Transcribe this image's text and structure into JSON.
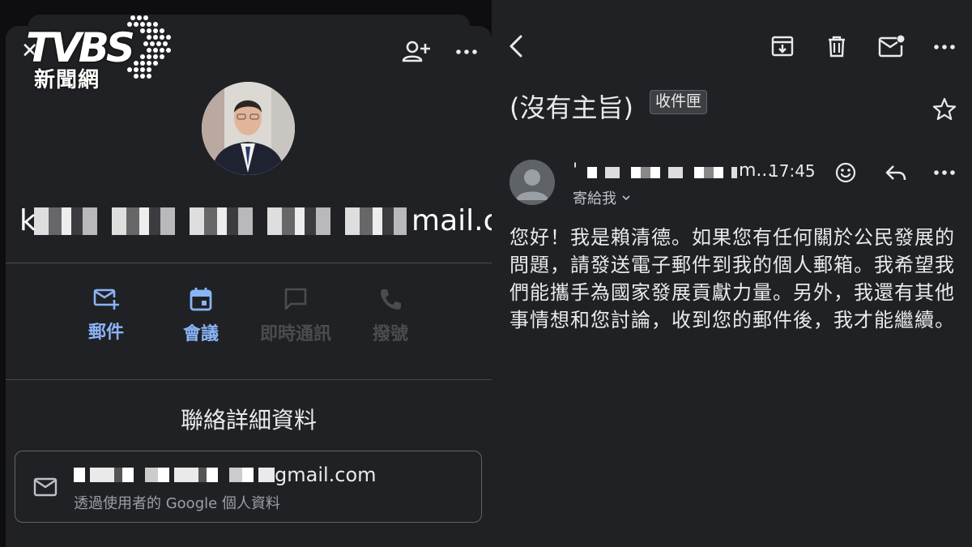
{
  "watermark": {
    "brand": "TVBS",
    "subtitle": "新聞網"
  },
  "contact_card": {
    "email_visible_start": "k",
    "email_visible_end": "mail.com",
    "actions": [
      {
        "label": "郵件",
        "icon": "mail-add-icon",
        "enabled": true
      },
      {
        "label": "會議",
        "icon": "calendar-icon",
        "enabled": true
      },
      {
        "label": "即時通訊",
        "icon": "chat-icon",
        "enabled": false
      },
      {
        "label": "撥號",
        "icon": "phone-icon",
        "enabled": false
      }
    ],
    "section_title": "聯絡詳細資料",
    "detail": {
      "value_suffix": "gmail.com",
      "note": "透過使用者的 Google 個人資料"
    }
  },
  "email_view": {
    "subject": "(沒有主旨)",
    "folder": "收件匣",
    "sender_ellipsis": "m...",
    "time": "17:45",
    "recipient": "寄給我",
    "body": "您好！我是賴清德。如果您有任何關於公民發展的問題，請發送電子郵件到我的個人郵箱。我希望我們能攜手為國家發展貢獻力量。另外，我還有其他事情想和您討論，收到您的郵件後，我才能繼續。"
  },
  "colors": {
    "accent": "#8ab4f8",
    "surface": "#202124",
    "disabled": "#4a4c50"
  }
}
